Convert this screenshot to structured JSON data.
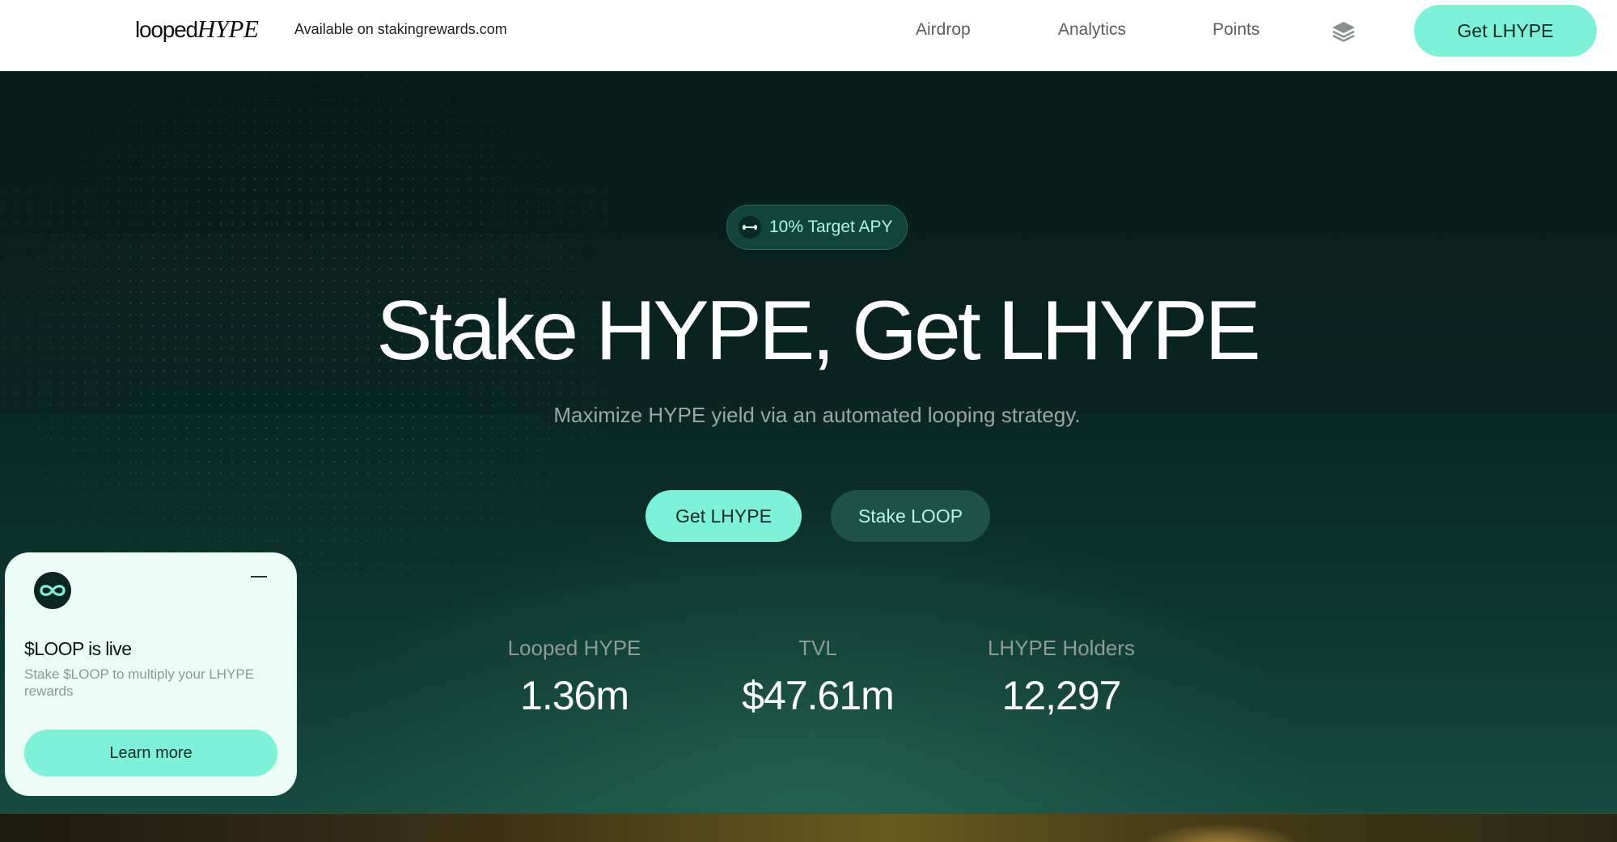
{
  "header": {
    "logo_part1": "looped",
    "logo_part2": "HYPE",
    "available": "Available on stakingrewards.com",
    "nav": [
      "Airdrop",
      "Analytics",
      "Points"
    ],
    "cta_label": "Get LHYPE"
  },
  "hero": {
    "badge": "10% Target APY",
    "title": "Stake HYPE, Get LHYPE",
    "subtitle": "Maximize HYPE yield via an automated looping strategy.",
    "primary_button": "Get LHYPE",
    "secondary_button": "Stake LOOP",
    "stats": [
      {
        "label": "Looped HYPE",
        "value": "1.36m"
      },
      {
        "label": "TVL",
        "value": "$47.61m"
      },
      {
        "label": "LHYPE Holders",
        "value": "12,297"
      }
    ]
  },
  "popup": {
    "title": "$LOOP is live",
    "description": "Stake $LOOP to multiply your LHYPE rewards",
    "button": "Learn more"
  },
  "colors": {
    "accent": "#7ef2d9",
    "hero_bg": "#0a2622",
    "header_bg": "#ffffff"
  }
}
